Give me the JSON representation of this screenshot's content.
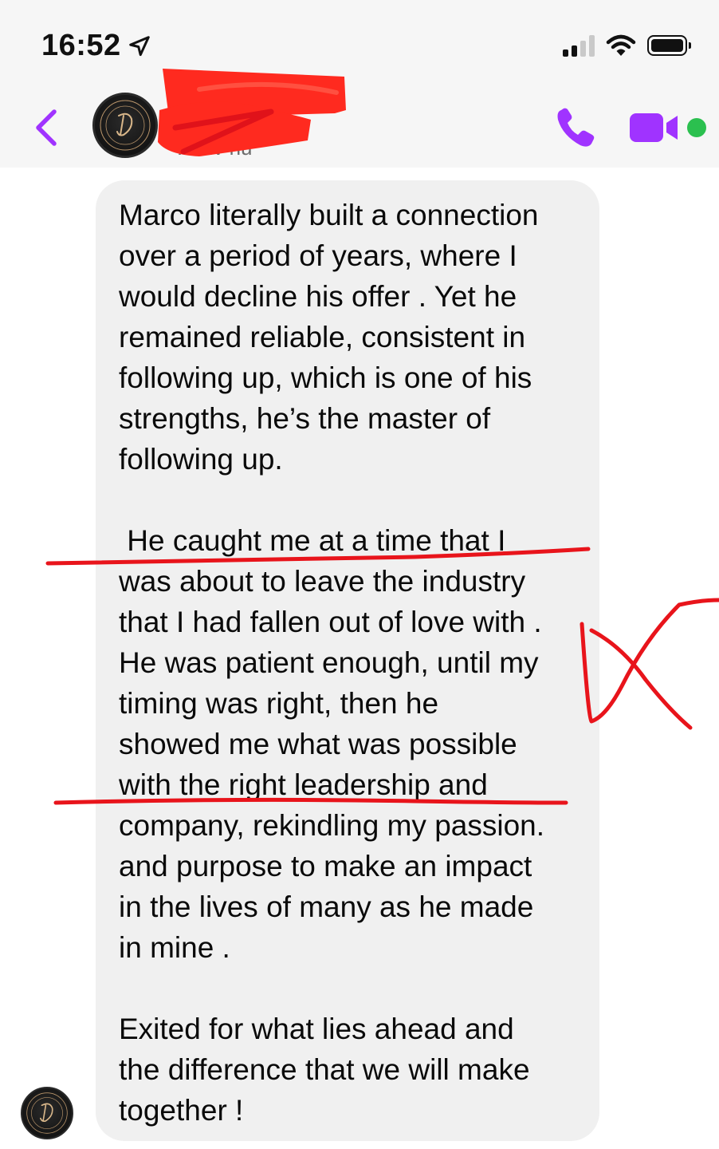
{
  "status_bar": {
    "time": "16:52"
  },
  "header": {
    "contact_name_visible": "s",
    "contact_status": "Aktiv nu"
  },
  "message": {
    "paragraph_1": [
      "Marco literally built a connection",
      "over a period of years, where I",
      "would decline his offer . Yet he",
      "remained reliable, consistent in",
      "following up, which is one of his",
      "strengths, he’s the master of",
      "following up."
    ],
    "paragraph_2": [
      " He caught me at a time that I",
      "was about to leave the industry",
      "that I had fallen out of love with .",
      "He was patient enough, until my",
      "timing was right, then he",
      "showed me what was possible",
      "with the right leadership and",
      "company, rekindling my passion.",
      "and purpose to make an impact",
      "in the lives of many as he made",
      "in mine ."
    ],
    "paragraph_3": [
      "Exited for what lies ahead and",
      "the difference that we will make",
      "together !"
    ]
  },
  "icons": {
    "back": "chevron-left-icon",
    "call": "phone-icon",
    "video": "video-camera-icon",
    "location": "location-arrow-icon"
  },
  "colors": {
    "accent": "#a033ff",
    "online": "#2bc04f",
    "bubble": "#f0f0f0",
    "annotation": "#e8141b"
  }
}
